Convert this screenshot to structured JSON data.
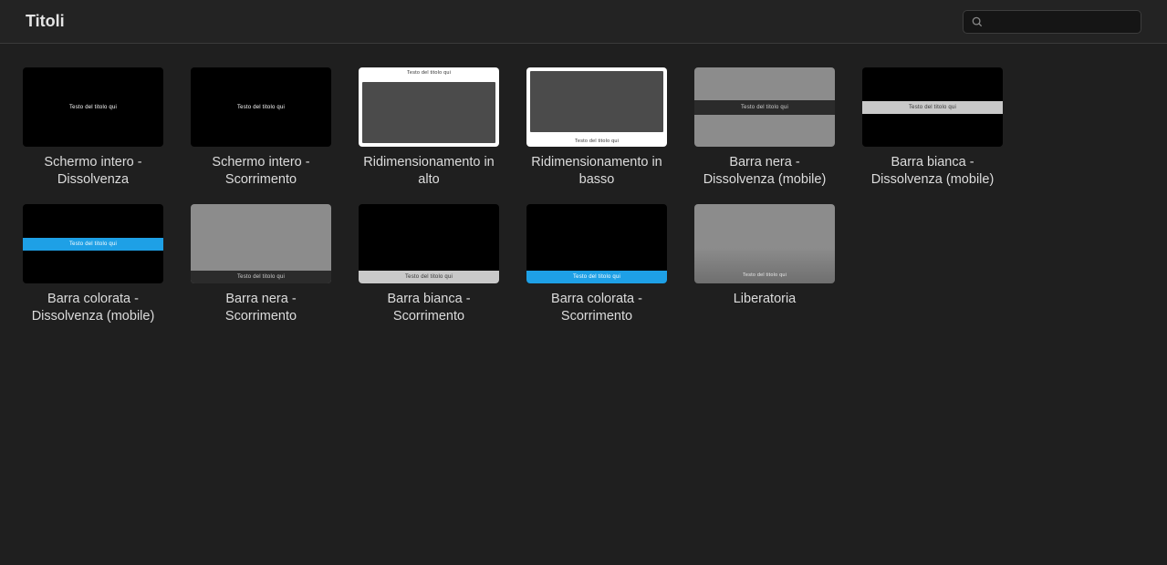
{
  "header": {
    "title": "Titoli",
    "search_placeholder": ""
  },
  "placeholder_text": "Testo del titolo qui",
  "titles": [
    {
      "label": "Schermo intero - Dissolvenza",
      "style": "t-full-center"
    },
    {
      "label": "Schermo intero - Scorrimento",
      "style": "t-full-center"
    },
    {
      "label": "Ridimensionamento in alto",
      "style": "t-resize-top"
    },
    {
      "label": "Ridimensionamento in basso",
      "style": "t-resize-bottom"
    },
    {
      "label": "Barra nera - Dissolvenza (mobile)",
      "style": "t-blackbar-mid"
    },
    {
      "label": "Barra bianca - Dissolvenza (mobile)",
      "style": "t-whitebar-mid"
    },
    {
      "label": "Barra colorata - Dissolvenza (mobile)",
      "style": "t-colorbar-mid"
    },
    {
      "label": "Barra nera - Scorrimento",
      "style": "t-blackbar-bot"
    },
    {
      "label": "Barra bianca - Scorrimento",
      "style": "t-whitebar-bot"
    },
    {
      "label": "Barra colorata - Scorrimento",
      "style": "t-colorbar-bot"
    },
    {
      "label": "Liberatoria",
      "style": "t-liberatoria"
    }
  ]
}
